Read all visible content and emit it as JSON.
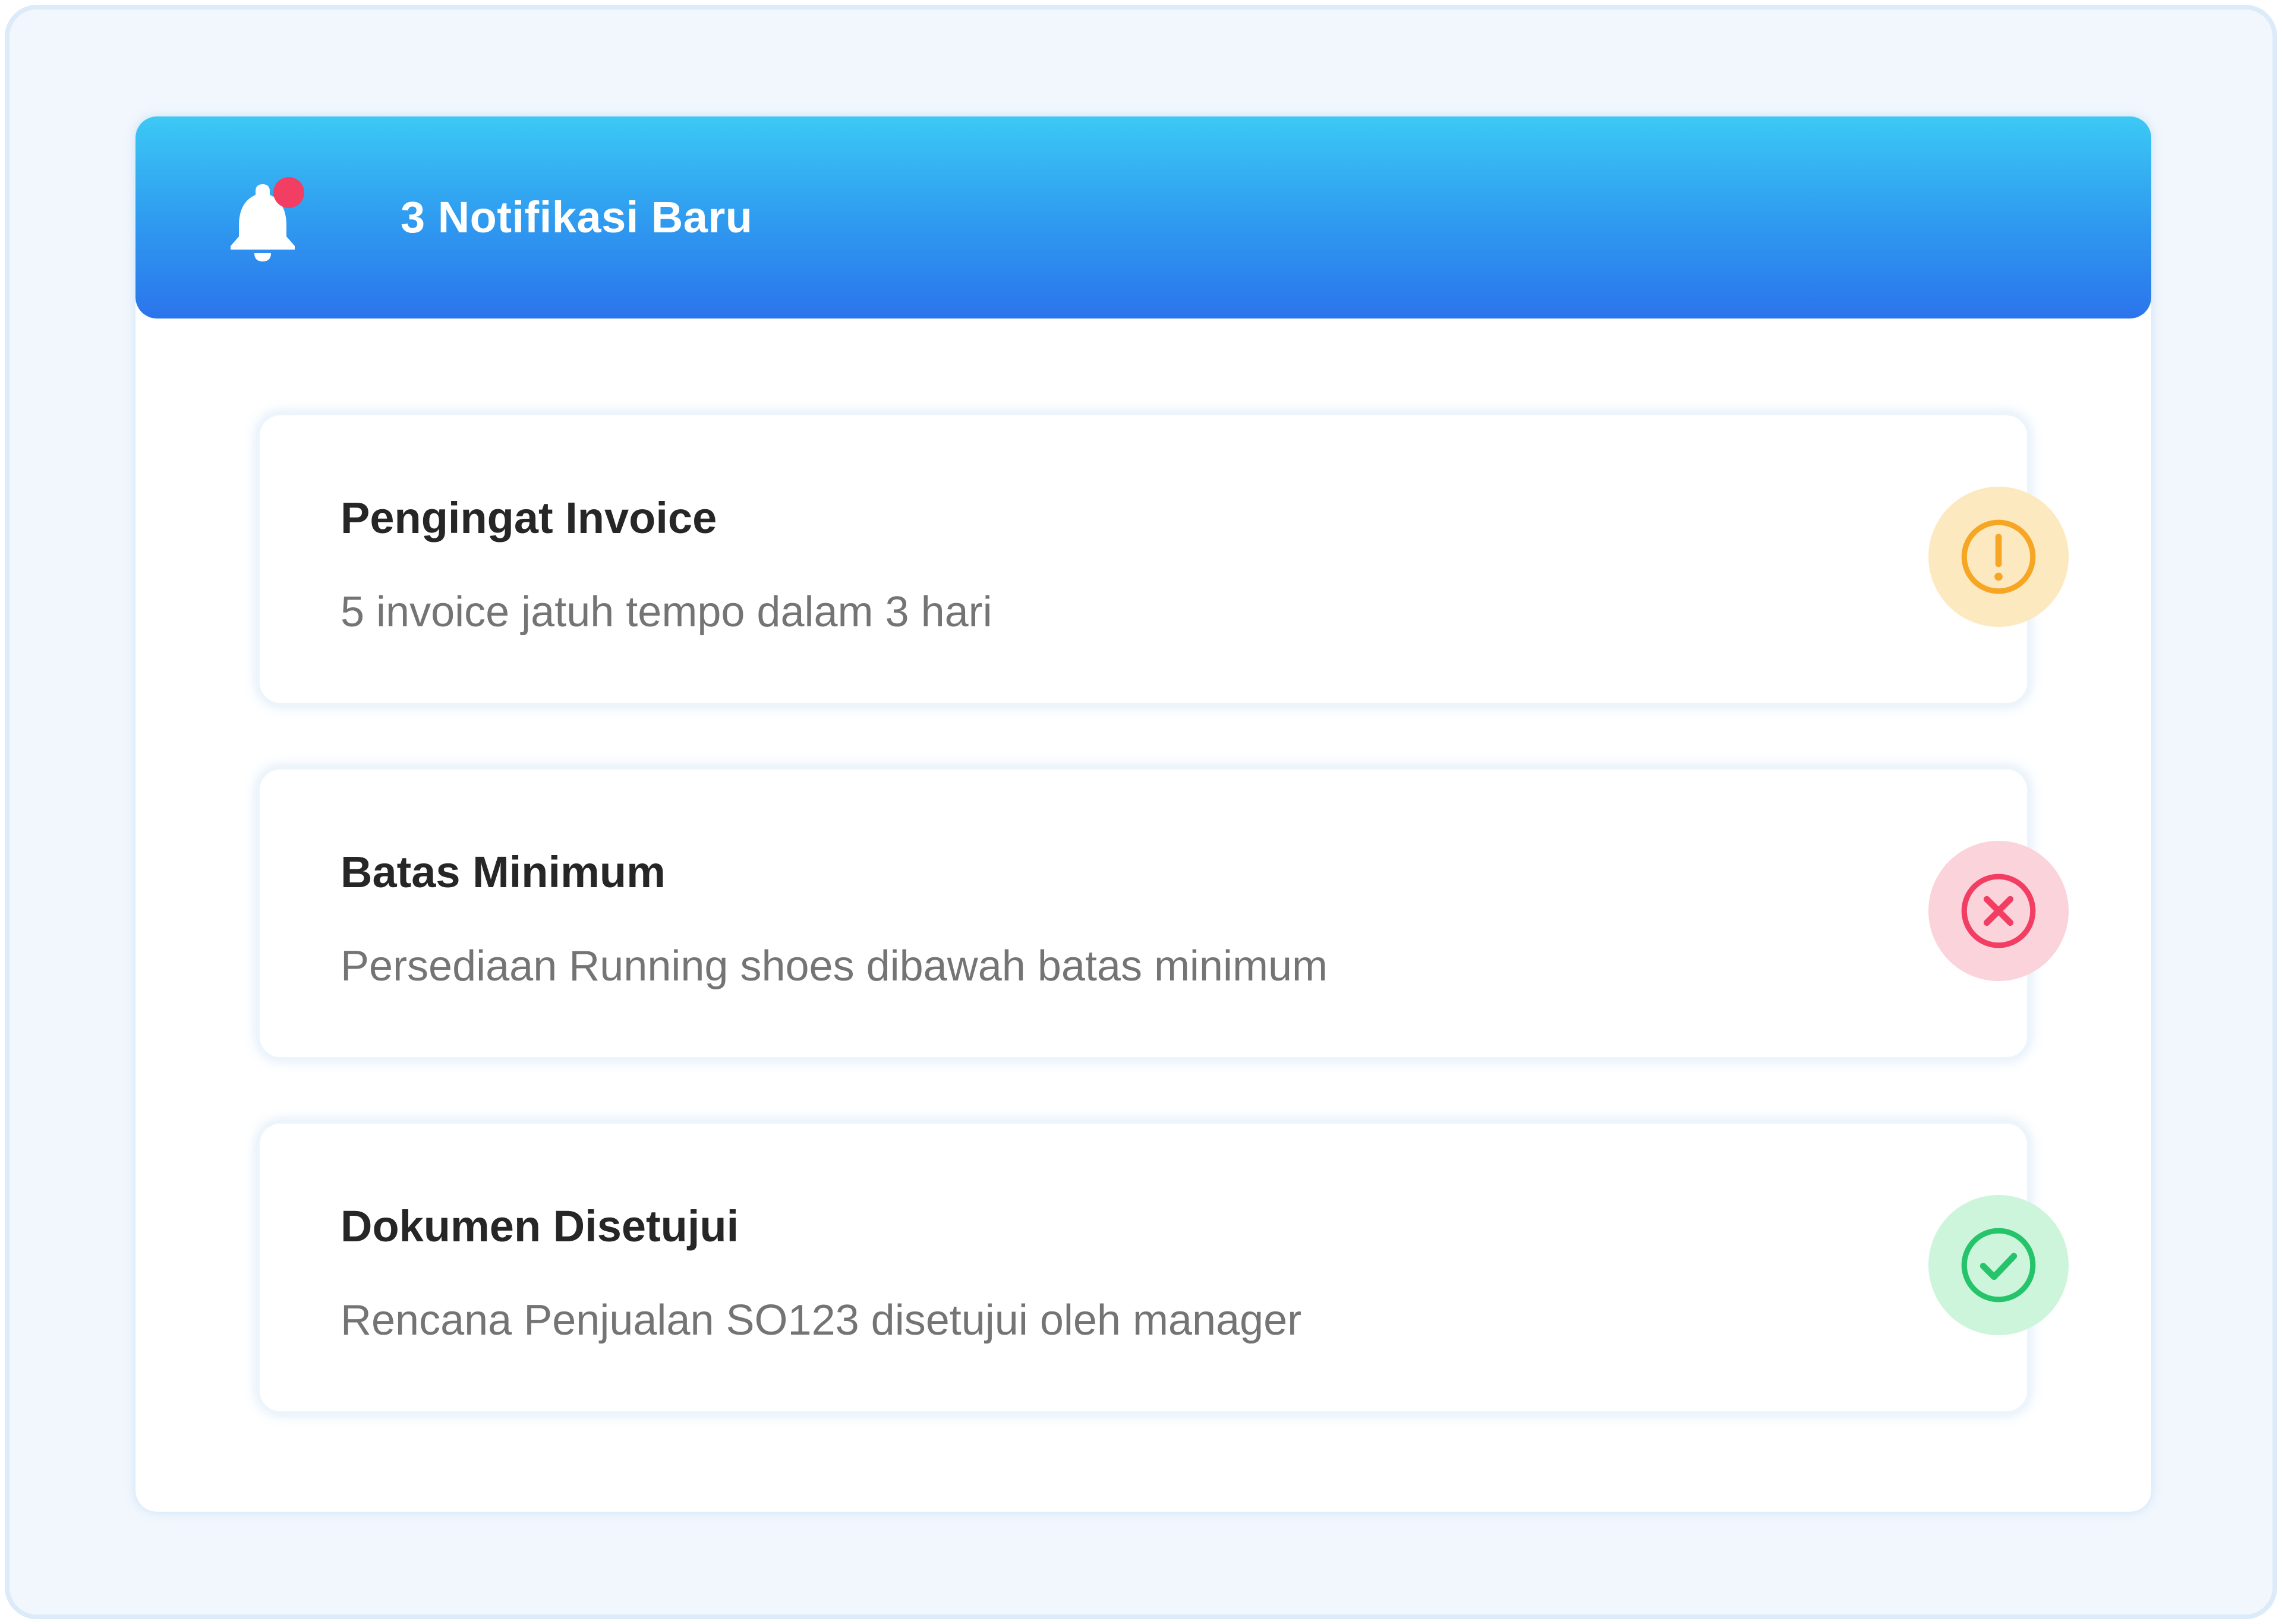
{
  "header": {
    "title": "3 Notifikasi Baru",
    "icon": "bell-icon",
    "gradient": [
      "#3cc9f5",
      "#2b74ec"
    ],
    "badge_color": "#f23e63"
  },
  "notifications": [
    {
      "title": "Pengingat Invoice",
      "description": "5 invoice jatuh tempo dalam 3 hari",
      "status": "warning",
      "icon": "exclamation-circle-icon",
      "icon_color": "#f6a623",
      "icon_bg": "#fde9bf"
    },
    {
      "title": "Batas Minimum",
      "description": "Persediaan Running shoes dibawah batas minimum",
      "status": "error",
      "icon": "x-circle-icon",
      "icon_color": "#f23e63",
      "icon_bg": "#fbd3da"
    },
    {
      "title": "Dokumen Disetujui",
      "description": "Rencana Penjualan SO123 disetujui oleh manager",
      "status": "success",
      "icon": "check-circle-icon",
      "icon_color": "#25c46b",
      "icon_bg": "#cdf5dc"
    }
  ]
}
